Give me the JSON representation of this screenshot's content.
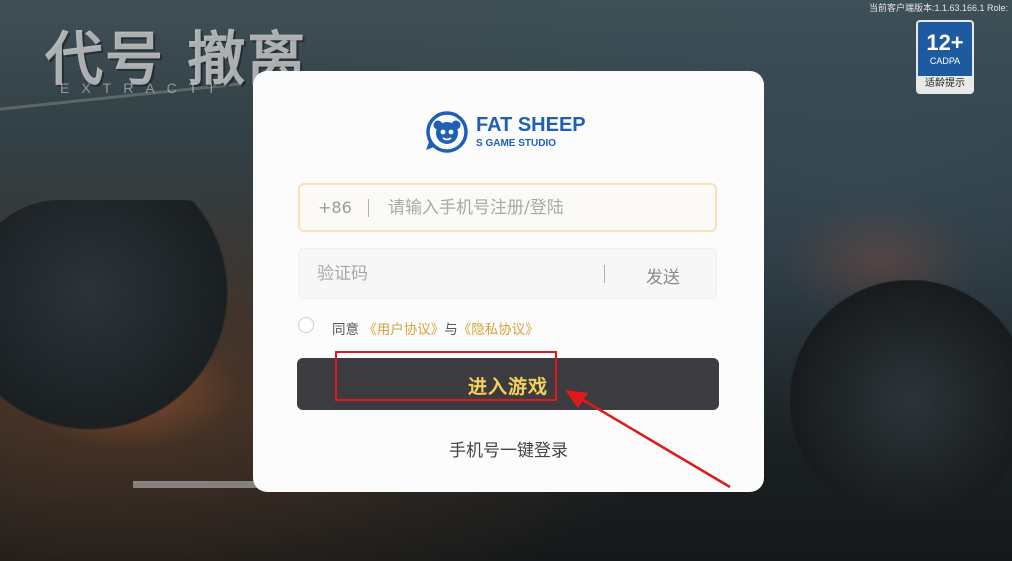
{
  "game": {
    "title": "代号 撤离",
    "subtitle": "EXTRACTI",
    "version_text": "当前客户端版本:1.1.63.166.1 Role:"
  },
  "age_rating": {
    "age": "12+",
    "org": "CADPA",
    "note": "适龄提示"
  },
  "studio": {
    "name": "FAT SHEEP",
    "sub": "S GAME STUDIO",
    "icon": "sheep-logo-icon",
    "brand_color": "#1f5fb8"
  },
  "login": {
    "phone_prefix": "+86",
    "phone_placeholder": "请输入手机号注册/登陆",
    "phone_value": "",
    "code_placeholder": "验证码",
    "code_value": "",
    "send_label": "发送",
    "agree_prefix": "同意",
    "user_agreement": "《用户协议》",
    "agree_and": "与",
    "privacy_policy": "《隐私协议》",
    "agree_checked": false,
    "enter_label": "进入游戏",
    "one_key_label": "手机号一键登录"
  },
  "annotation": {
    "color": "#e01a1a",
    "target": "enter-game-button"
  }
}
